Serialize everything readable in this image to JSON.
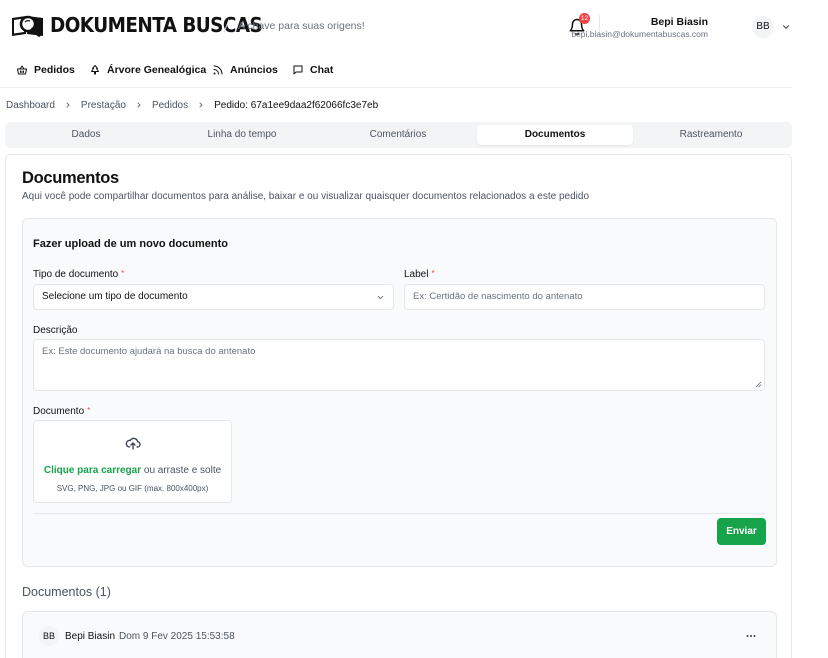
{
  "header": {
    "brand": "DOKUMENTA BUSCAS",
    "tagline": "A chave para suas origens!",
    "notification_count": "12",
    "user_name": "Bepi Biasin",
    "user_email": "bepi.biasin@dokumentabuscas.com",
    "user_initials": "BB"
  },
  "nav": {
    "items": [
      {
        "label": "Pedidos",
        "icon": "basket-icon"
      },
      {
        "label": "Árvore Genealógica",
        "icon": "tree-icon"
      },
      {
        "label": "Anúncios",
        "icon": "rss-icon"
      },
      {
        "label": "Chat",
        "icon": "chat-icon"
      }
    ]
  },
  "breadcrumb": {
    "items": [
      "Dashboard",
      "Prestação",
      "Pedidos"
    ],
    "current": "Pedido: 67a1ee9daa2f62066fc3e7eb"
  },
  "tabs": {
    "items": [
      "Dados",
      "Linha do tempo",
      "Comentários",
      "Documentos",
      "Rastreamento"
    ],
    "active": "Documentos"
  },
  "documents": {
    "title": "Documentos",
    "subtitle": "Aqui você pode compartilhar documentos para análise, baixar e ou visualizar quaisquer documentos relacionados a este pedido",
    "upload": {
      "title": "Fazer upload de um novo documento",
      "type_label": "Tipo de documento",
      "type_value": "Selecione um tipo de documento",
      "label_label": "Label",
      "label_placeholder": "Ex: Certidão de nascimento do antenato",
      "description_label": "Descrição",
      "description_placeholder": "Ex: Este documento ajudará na busca do antenato",
      "document_label": "Documento",
      "required_mark": "*",
      "dropzone_link": "Clique para carregar",
      "dropzone_text": " ou arraste e solte",
      "dropzone_hint": "SVG, PNG, JPG ou GIF (max. 800x400px)",
      "submit_label": "Enviar"
    },
    "list_heading": "Documentos (1)",
    "list": [
      {
        "initials": "BB",
        "author": "Bepi Biasin",
        "date": "Dom 9 Fev 2025 15:53:58"
      }
    ]
  },
  "colors": {
    "accent": "#16a34a",
    "badge": "#ef4444",
    "required": "#ef4444"
  }
}
